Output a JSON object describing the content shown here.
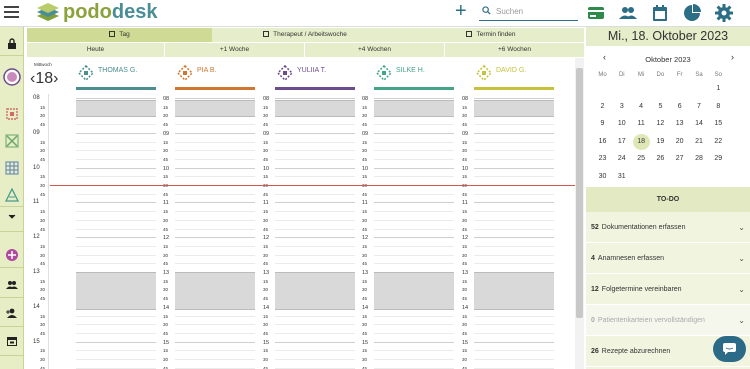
{
  "app": {
    "name_a": "podo",
    "name_b": "desk"
  },
  "search": {
    "placeholder": "Suchen"
  },
  "tabs": [
    {
      "label": "Tag"
    },
    {
      "label": "Therapeut / Arbeitswoche"
    },
    {
      "label": "Termin finden"
    }
  ],
  "quick": [
    {
      "label": "Heute"
    },
    {
      "label": "+1 Woche"
    },
    {
      "label": "+4 Wochen"
    },
    {
      "label": "+6 Wochen"
    }
  ],
  "date_header": "Mi., 18. Oktober 2023",
  "calendar": {
    "month": "Oktober 2023",
    "prev": "‹",
    "next": "›",
    "weekdays": [
      "Mo",
      "Di",
      "Mi",
      "Do",
      "Fr",
      "Sa",
      "So"
    ],
    "weeks": [
      [
        "",
        "",
        "",
        "",
        "",
        "",
        "1"
      ],
      [
        "2",
        "3",
        "4",
        "5",
        "6",
        "7",
        "8"
      ],
      [
        "9",
        "10",
        "11",
        "12",
        "13",
        "14",
        "15"
      ],
      [
        "16",
        "17",
        "18",
        "19",
        "20",
        "21",
        "22"
      ],
      [
        "23",
        "24",
        "25",
        "26",
        "27",
        "28",
        "29"
      ],
      [
        "30",
        "31",
        "",
        "",
        "",
        "",
        ""
      ]
    ],
    "selected": "18"
  },
  "todo": {
    "title": "TO-DO",
    "items": [
      {
        "count": "52",
        "label": "Dokumentationen erfassen",
        "disabled": false
      },
      {
        "count": "4",
        "label": "Anamnesen erfassen",
        "disabled": false
      },
      {
        "count": "12",
        "label": "Folgetermine vereinbaren",
        "disabled": false
      },
      {
        "count": "0",
        "label": "Patientenkarteien vervollständigen",
        "disabled": true
      },
      {
        "count": "26",
        "label": "Rezepte abzurechnen",
        "disabled": false
      }
    ]
  },
  "day_view": {
    "weekday": "Mittwoch",
    "day": "18",
    "prev": "‹",
    "next": "›",
    "hours": [
      "08",
      "09",
      "10",
      "11",
      "12",
      "13",
      "14",
      "15"
    ],
    "minutes": [
      "15",
      "30",
      "45"
    ],
    "therapists": [
      {
        "name": "THOMAS G.",
        "color": "#4b8e8d"
      },
      {
        "name": "PIA B.",
        "color": "#d0772f"
      },
      {
        "name": "YULIIA T.",
        "color": "#6b4d8f"
      },
      {
        "name": "SILKE H.",
        "color": "#43a48a"
      },
      {
        "name": "DAVID G.",
        "color": "#c6c23a"
      }
    ]
  },
  "colors": {
    "accent": "#2c6e86",
    "brand_green": "#8aa33a",
    "now_line": "#d9534f"
  }
}
